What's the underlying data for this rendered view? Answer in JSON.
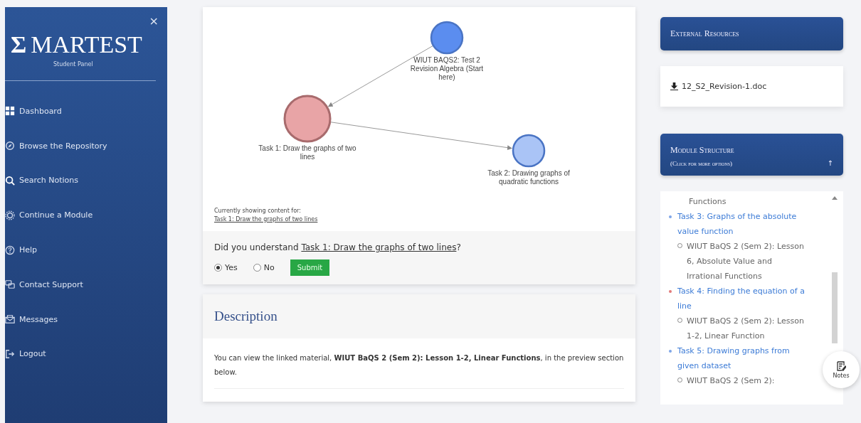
{
  "sidebar": {
    "logo_symbol": "Σ",
    "logo_text": "MARTEST",
    "subtitle": "Student Panel",
    "close": "×",
    "items": [
      {
        "label": "Dashboard"
      },
      {
        "label": "Browse the Repository"
      },
      {
        "label": "Search Notions"
      },
      {
        "label": "Continue a Module"
      },
      {
        "label": "Help"
      },
      {
        "label": "Contact Support"
      },
      {
        "label": "Messages"
      },
      {
        "label": "Logout"
      }
    ]
  },
  "graph": {
    "nodes": [
      {
        "label": "WIUT BAQS2: Test 2 Revision Algebra (Start here)",
        "color": "#5b8def",
        "current": false
      },
      {
        "label": "Task 1: Draw the graphs of two lines",
        "color": "#e8a4a6",
        "current": true
      },
      {
        "label": "Task 2: Drawing graphs of quadratic functions",
        "color": "#aac4f6",
        "current": false
      }
    ],
    "caption": "Currently showing content for:",
    "current_link": "Task 1: Draw the graphs of two lines"
  },
  "question": {
    "prefix": "Did you understand ",
    "link": "Task 1: Draw the graphs of two lines",
    "suffix": "?",
    "options": [
      {
        "label": "Yes",
        "selected": true
      },
      {
        "label": "No",
        "selected": false
      }
    ],
    "submit": "Submit"
  },
  "description": {
    "title": "Description",
    "text": "You can view the linked material, **WIUT BaQS 2 (Sem 2): Lesson 1-2, Linear Functions**, in the preview section below."
  },
  "external": {
    "title": "External Resources",
    "files": [
      "12_S2_Revision-1.doc"
    ]
  },
  "module": {
    "title": "Module Structure",
    "subtitle": "(Click for more options)",
    "toggle": "↑",
    "lead": "Functions",
    "tasks": [
      {
        "label": "Task 3: Graphs of the absolute value function",
        "color": "#7fa6e8",
        "lessons": [
          "WIUT BaQS 2 (Sem 2): Lesson 6, Absolute Value and Irrational Functions"
        ]
      },
      {
        "label": "Task 4: Finding the equation of a line",
        "color": "#e27a7a",
        "lessons": [
          "WIUT BaQS 2 (Sem 2): Lesson 1-2, Linear Function"
        ]
      },
      {
        "label": "Task 5: Drawing graphs from given dataset",
        "color": "#7fa6e8",
        "lessons": [
          "WIUT BaQS 2 (Sem 2):"
        ]
      }
    ]
  },
  "notes": {
    "label": "Notes"
  }
}
